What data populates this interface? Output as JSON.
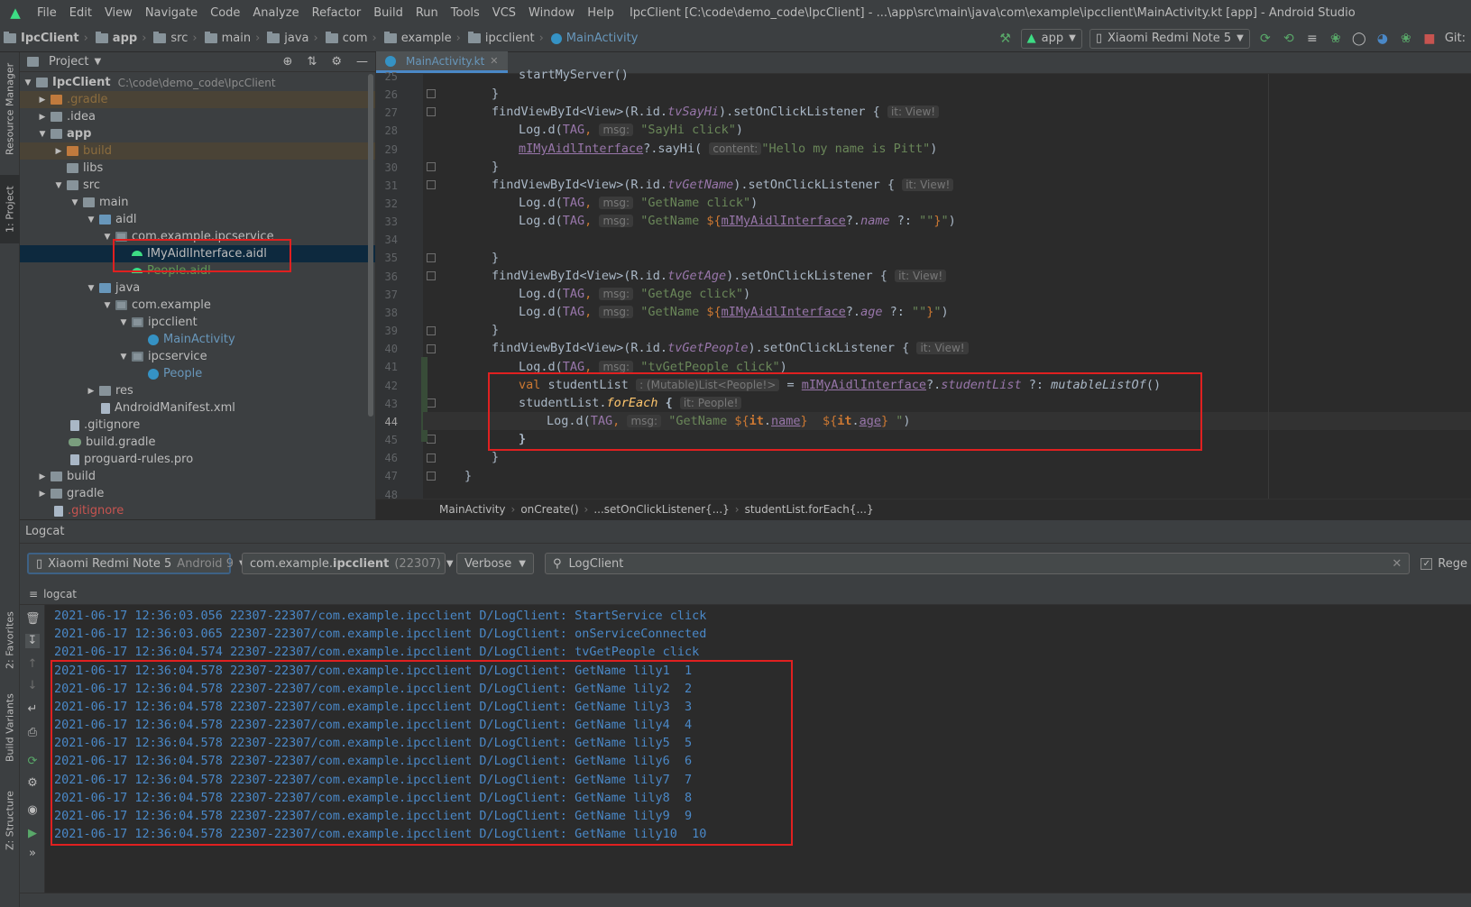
{
  "menu": [
    "File",
    "Edit",
    "View",
    "Navigate",
    "Code",
    "Analyze",
    "Refactor",
    "Build",
    "Run",
    "Tools",
    "VCS",
    "Window",
    "Help"
  ],
  "window_title": "IpcClient [C:\\code\\demo_code\\IpcClient] - ...\\app\\src\\main\\java\\com\\example\\ipcclient\\MainActivity.kt [app] - Android Studio",
  "breadcrumb": [
    "IpcClient",
    "app",
    "src",
    "main",
    "java",
    "com",
    "example",
    "ipcclient",
    "MainActivity"
  ],
  "toolbar": {
    "config": "app",
    "device": "Xiaomi Redmi Note 5",
    "git": "Git:"
  },
  "side_tabs": [
    "Resource Manager",
    "1: Project",
    "2: Favorites",
    "Build Variants",
    "Z: Structure"
  ],
  "project": {
    "header": "Project",
    "tree": [
      {
        "label": "IpcClient",
        "extra": "C:\\code\\demo_code\\IpcClient"
      },
      {
        "label": ".gradle"
      },
      {
        "label": ".idea"
      },
      {
        "label": "app"
      },
      {
        "label": "build"
      },
      {
        "label": "libs"
      },
      {
        "label": "src"
      },
      {
        "label": "main"
      },
      {
        "label": "aidl"
      },
      {
        "label": "com.example.ipcservice"
      },
      {
        "label": "IMyAidlInterface.aidl"
      },
      {
        "label": "People.aidl"
      },
      {
        "label": "java"
      },
      {
        "label": "com.example"
      },
      {
        "label": "ipcclient"
      },
      {
        "label": "MainActivity"
      },
      {
        "label": "ipcservice"
      },
      {
        "label": "People"
      },
      {
        "label": "res"
      },
      {
        "label": "AndroidManifest.xml"
      },
      {
        "label": ".gitignore"
      },
      {
        "label": "build.gradle"
      },
      {
        "label": "proguard-rules.pro"
      },
      {
        "label": "build"
      },
      {
        "label": "gradle"
      },
      {
        "label": ".gitignore"
      }
    ]
  },
  "editor": {
    "tab": "MainActivity.kt",
    "line_numbers": [
      "25",
      "26",
      "27",
      "28",
      "29",
      "30",
      "31",
      "32",
      "33",
      "34",
      "35",
      "36",
      "37",
      "38",
      "39",
      "40",
      "41",
      "42",
      "43",
      "44",
      "45",
      "46",
      "47",
      "48"
    ],
    "code": {
      "l25": {
        "a": "startMyServer()"
      },
      "l26": {
        "a": "}"
      },
      "l27": {
        "a": "findViewById<View>(R.id.",
        "b": "tvSayHi",
        "c": ").setOnClickListener {",
        "h": "it: View!"
      },
      "l28": {
        "a": "Log.d(",
        "b": "TAG",
        ",": ",",
        "h": "msg:",
        "s": "\"SayHi click\"",
        "c": ")"
      },
      "l29": {
        "a": "mIMyAidlInterface",
        "b": "?.sayHi(",
        "h": "content:",
        "s": "\"Hello my name is Pitt\"",
        "c": ")"
      },
      "l30": {
        "a": "}"
      },
      "l31": {
        "a": "findViewById<View>(R.id.",
        "b": "tvGetName",
        "c": ").setOnClickListener {",
        "h": "it: View!"
      },
      "l32": {
        "a": "Log.d(",
        "b": "TAG",
        ",": ",",
        "h": "msg:",
        "s": "\"GetName click\"",
        "c": ")"
      },
      "l33": {
        "a": "Log.d(",
        "b": "TAG",
        ",": ",",
        "h": "msg:",
        "s1": "\"GetName ",
        "i1": "${",
        "v": "mIMyAidlInterface",
        "q": "?.",
        "f": "name",
        "e": " ?: ",
        "s2": "\"\"",
        "i2": "}",
        "s3": "\"",
        "c": ")"
      },
      "l35": {
        "a": "}"
      },
      "l36": {
        "a": "findViewById<View>(R.id.",
        "b": "tvGetAge",
        "c": ").setOnClickListener {",
        "h": "it: View!"
      },
      "l37": {
        "a": "Log.d(",
        "b": "TAG",
        ",": ",",
        "h": "msg:",
        "s": "\"GetAge click\"",
        "c": ")"
      },
      "l38": {
        "a": "Log.d(",
        "b": "TAG",
        ",": ",",
        "h": "msg:",
        "s1": "\"GetName ",
        "i1": "${",
        "v": "mIMyAidlInterface",
        "q": "?.",
        "f": "age",
        "e": " ?: ",
        "s2": "\"\"",
        "i2": "}",
        "s3": "\"",
        "c": ")"
      },
      "l39": {
        "a": "}"
      },
      "l40": {
        "a": "findViewById<View>(R.id.",
        "b": "tvGetPeople",
        "c": ").setOnClickListener {",
        "h": "it: View!"
      },
      "l41": {
        "a": "Log.d(",
        "b": "TAG",
        ",": ",",
        "h": "msg:",
        "s": "\"tvGetPeople click\"",
        "c": ")"
      },
      "l42": {
        "k": "val",
        "a": " studentList ",
        "h": ": (Mutable)List<People!>",
        "eq": " = ",
        "v": "mIMyAidlInterface",
        "q": "?.",
        "f": "studentList",
        "e": " ?: ",
        "m": "mutableListOf",
        "c": "()"
      },
      "l43": {
        "a": "studentList.",
        "f": "forEach",
        "c": " {",
        "h": "it: People!"
      },
      "l44": {
        "a": "Log.d(",
        "b": "TAG",
        ",": ",",
        "h": "msg:",
        "s1": "\"GetName ",
        "i1": "${",
        "it1": "it",
        "d1": ".",
        "p1": "name",
        "i2": "}",
        "sp": "  ",
        "i3": "${",
        "it2": "it",
        "d2": ".",
        "p2": "age",
        "i4": "}",
        "s3": " \"",
        "c": ")"
      },
      "l45": {
        "a": "}"
      },
      "l46": {
        "a": "}"
      },
      "l47": {
        "a": "}"
      }
    },
    "breadcrumbs": [
      "MainActivity",
      "onCreate()",
      "...setOnClickListener{...}",
      "studentList.forEach{...}"
    ]
  },
  "logcat": {
    "title": "Logcat",
    "device": "Xiaomi Redmi Note 5",
    "device_os": "Android 9",
    "process_prefix": "com.example.",
    "process_bold": "ipcclient",
    "process_pid": "(22307)",
    "level": "Verbose",
    "search": "LogClient",
    "regex_label": "Rege",
    "sub": "logcat",
    "lines": [
      "2021-06-17 12:36:03.056 22307-22307/com.example.ipcclient D/LogClient: StartService click",
      "2021-06-17 12:36:03.065 22307-22307/com.example.ipcclient D/LogClient: onServiceConnected",
      "2021-06-17 12:36:04.574 22307-22307/com.example.ipcclient D/LogClient: tvGetPeople click",
      "2021-06-17 12:36:04.578 22307-22307/com.example.ipcclient D/LogClient: GetName lily1  1",
      "2021-06-17 12:36:04.578 22307-22307/com.example.ipcclient D/LogClient: GetName lily2  2",
      "2021-06-17 12:36:04.578 22307-22307/com.example.ipcclient D/LogClient: GetName lily3  3",
      "2021-06-17 12:36:04.578 22307-22307/com.example.ipcclient D/LogClient: GetName lily4  4",
      "2021-06-17 12:36:04.578 22307-22307/com.example.ipcclient D/LogClient: GetName lily5  5",
      "2021-06-17 12:36:04.578 22307-22307/com.example.ipcclient D/LogClient: GetName lily6  6",
      "2021-06-17 12:36:04.578 22307-22307/com.example.ipcclient D/LogClient: GetName lily7  7",
      "2021-06-17 12:36:04.578 22307-22307/com.example.ipcclient D/LogClient: GetName lily8  8",
      "2021-06-17 12:36:04.578 22307-22307/com.example.ipcclient D/LogClient: GetName lily9  9",
      "2021-06-17 12:36:04.578 22307-22307/com.example.ipcclient D/LogClient: GetName lily10  10"
    ]
  },
  "colors": {
    "accent": "#4a88c7",
    "highlight_box": "#e02020",
    "log_text": "#4a88c7"
  }
}
